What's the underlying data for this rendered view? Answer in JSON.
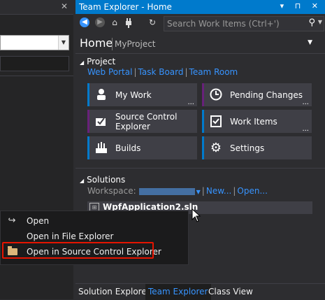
{
  "panel": {
    "title": "Team Explorer - Home",
    "title_controls": "▾ ⊓ ✕"
  },
  "toolbar": {
    "search_placeholder": "Search Work Items (Ctrl+')"
  },
  "header": {
    "home": "Home",
    "project": "MyProject"
  },
  "project_section": {
    "title": "Project",
    "links": [
      "Web Portal",
      "Task Board",
      "Team Room"
    ]
  },
  "tiles": [
    {
      "label": "My Work",
      "icon": "person-icon",
      "accent": "#007acc",
      "dots": "..."
    },
    {
      "label": "Pending Changes",
      "icon": "clock-icon",
      "accent": "#68217a",
      "dots": "..."
    },
    {
      "label": "Source Control\nExplorer",
      "icon": "source-control-icon",
      "accent": "#68217a",
      "dots": ""
    },
    {
      "label": "Work Items",
      "icon": "clipboard-icon",
      "accent": "#007acc",
      "dots": "..."
    },
    {
      "label": "Builds",
      "icon": "builds-icon",
      "accent": "#007acc",
      "dots": ""
    },
    {
      "label": "Settings",
      "icon": "gear-icon",
      "accent": "#007acc",
      "dots": ""
    }
  ],
  "solutions": {
    "title": "Solutions",
    "workspace_label": "Workspace:",
    "new_link": "New...",
    "open_link": "Open...",
    "solution_name": "WpfApplication2.sln"
  },
  "context_menu": {
    "items": [
      "Open",
      "Open in File Explorer",
      "Open in Source Control Explorer"
    ]
  },
  "bottom_tabs": [
    "Solution Explorer",
    "Team Explorer",
    "Class View"
  ],
  "colors": {
    "accent_blue": "#007acc",
    "accent_purple": "#68217a",
    "link": "#3794ff",
    "highlight": "#e51400"
  }
}
